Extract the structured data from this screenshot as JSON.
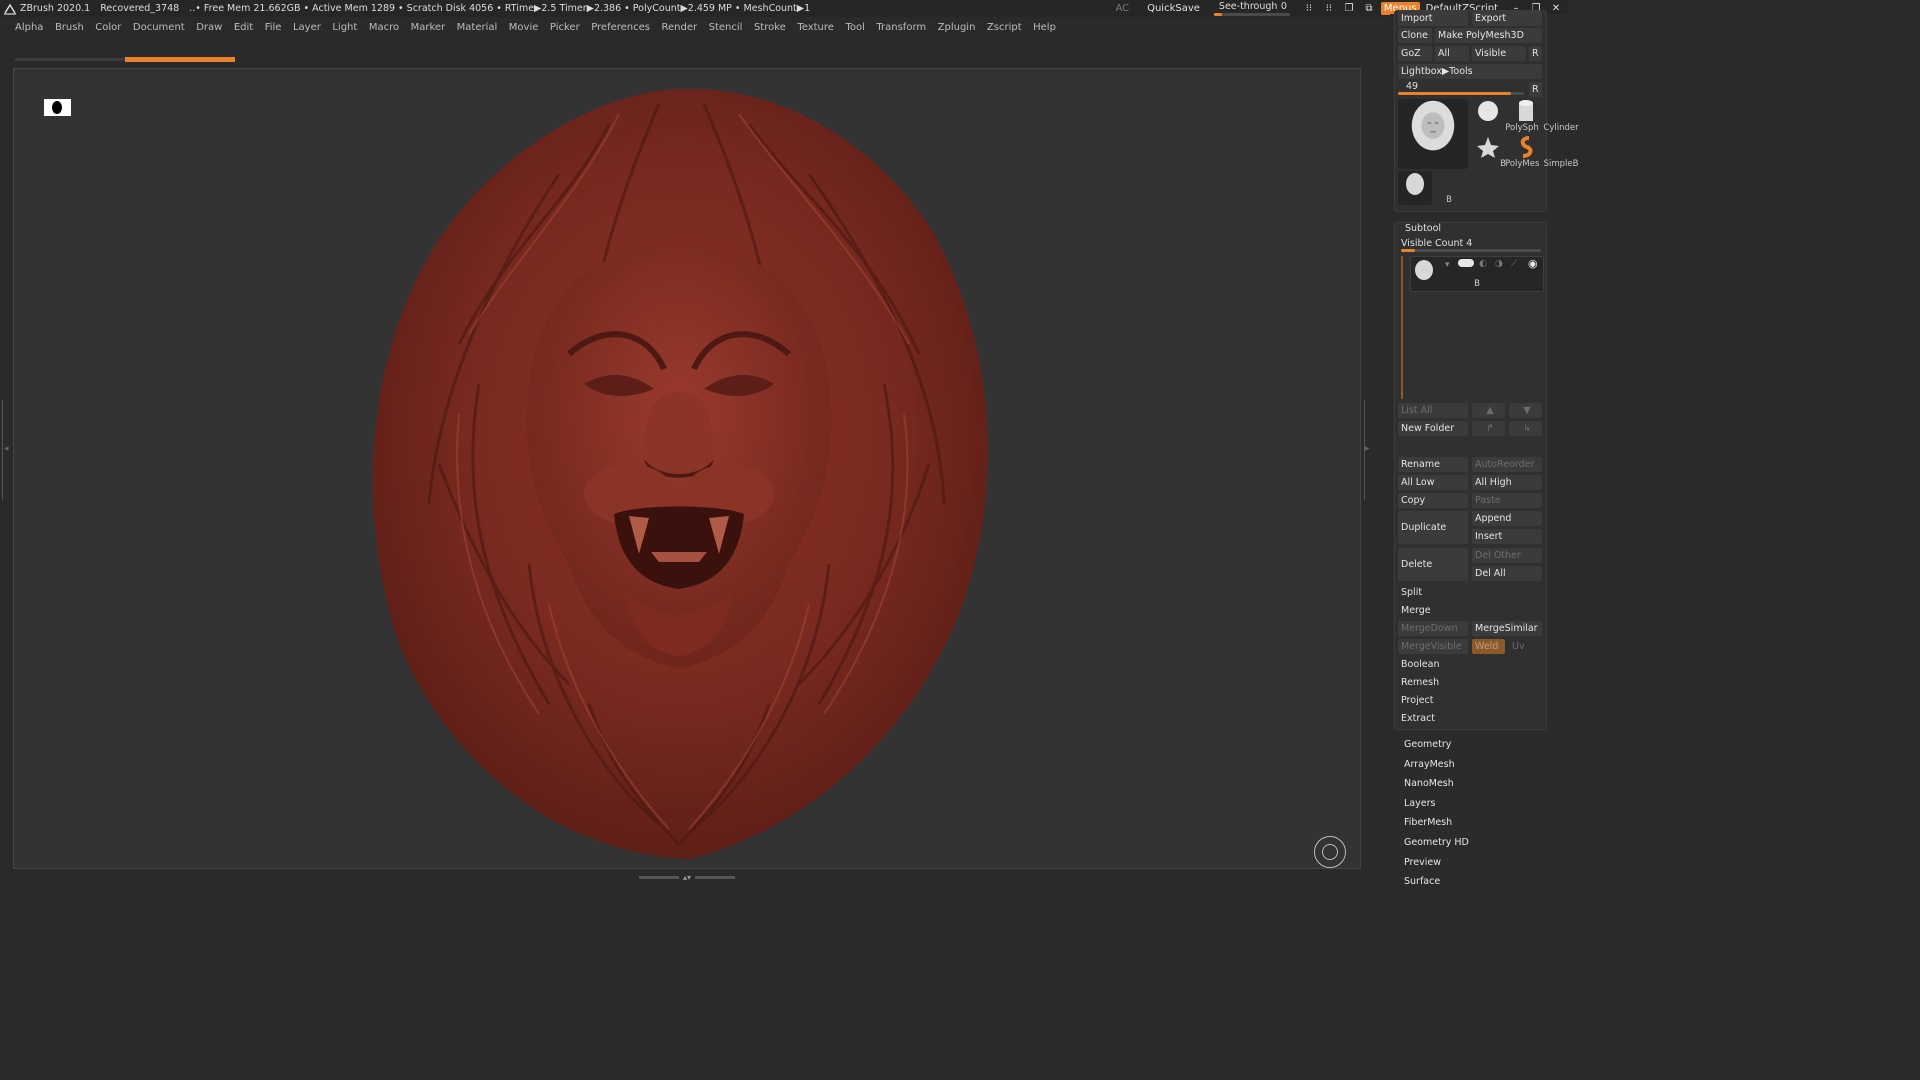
{
  "titlebar": {
    "app_name": "ZBrush 2020.1",
    "document": "Recovered_3748",
    "stats": "..• Free Mem 21.662GB • Active Mem 1289 • Scratch Disk 4056 •  RTime▶2.5 Timer▶2.386 • PolyCount▶2.459 MP  • MeshCount▶1",
    "ac": "AC",
    "quicksave": "QuickSave",
    "see_through_label": "See-through",
    "see_through_value": "0",
    "see_through_level": 0.1,
    "menus_label": "Menus",
    "default_zscript": "DefaultZScript",
    "accent": "#e8822c"
  },
  "menubar": [
    "Alpha",
    "Brush",
    "Color",
    "Document",
    "Draw",
    "Edit",
    "File",
    "Layer",
    "Light",
    "Macro",
    "Marker",
    "Material",
    "Movie",
    "Picker",
    "Preferences",
    "Render",
    "Stencil",
    "Stroke",
    "Texture",
    "Tool",
    "Transform",
    "Zplugin",
    "Zscript",
    "Help"
  ],
  "tool_panel": {
    "import": "Import",
    "export": "Export",
    "clone": "Clone",
    "make_polymesh": "Make PolyMesh3D",
    "goz": "GoZ",
    "all": "All",
    "visible": "Visible",
    "r": "R",
    "lightbox_tools": "Lightbox▶Tools",
    "tool_count": "49",
    "tool_slider_level": 0.9,
    "thumbs": [
      {
        "caption": "B"
      },
      {
        "caption": "PolySph"
      },
      {
        "caption": "Cylinder"
      },
      {
        "caption": "PolyMes"
      },
      {
        "caption": "SimpleB"
      },
      {
        "caption": "B"
      }
    ]
  },
  "subtool": {
    "title": "Subtool",
    "visible_count": "Visible Count 4",
    "item_caption": "B",
    "list_all": "List All",
    "new_folder": "New Folder",
    "rename": "Rename",
    "autoreorder": "AutoReorder",
    "all_low": "All Low",
    "all_high": "All High",
    "copy": "Copy",
    "paste": "Paste",
    "duplicate": "Duplicate",
    "append": "Append",
    "insert": "Insert",
    "delete": "Delete",
    "del_other": "Del Other",
    "del_all": "Del All",
    "split": "Split",
    "merge": "Merge",
    "mergedown": "MergeDown",
    "mergesimilar": "MergeSimilar",
    "mergevisible": "MergeVisible",
    "weld": "Weld",
    "uv": "Uv",
    "boolean": "Boolean",
    "remesh": "Remesh",
    "project": "Project",
    "extract": "Extract"
  },
  "menus": [
    "Geometry",
    "ArrayMesh",
    "NanoMesh",
    "Layers",
    "FiberMesh",
    "Geometry HD",
    "Preview",
    "Surface"
  ]
}
